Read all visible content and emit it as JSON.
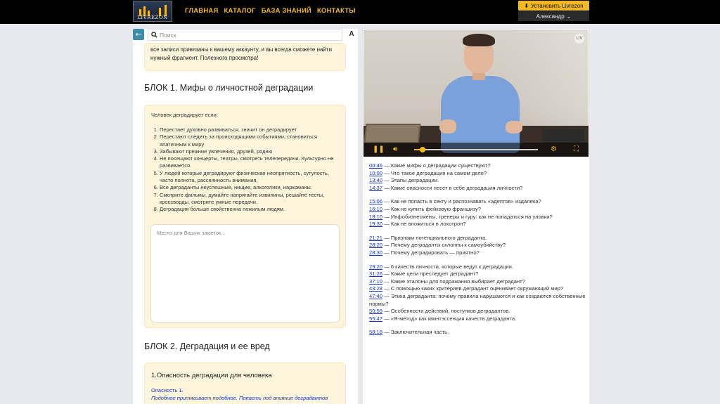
{
  "header": {
    "logo_text": "LIVREZON",
    "nav": [
      "ГЛАВНАЯ",
      "КАТАЛОГ",
      "БАЗА ЗНАНИЙ",
      "КОНТАКТЫ"
    ],
    "install_label": "Установить Livrezon",
    "user_name": "Александр",
    "accent_color": "#f3b81f"
  },
  "search": {
    "placeholder": "Поиск",
    "font_button": "A"
  },
  "notice": {
    "text": "все записи привязаны к вашему аккаунту, и вы всегда сможете найти нужный фрагмент. Полезного просмотра!"
  },
  "block1": {
    "title": "БЛОК 1. Мифы о личностной деградации",
    "intro": "Человек деградирует если:",
    "items": [
      "Перестает духовно развиваться, значит он деградирует",
      "Перестают следить за происходящими событиями, становиться апатичным к миру",
      "Забывают прежние увлечения, друзей, родню",
      "Не посещают концерты, театры, смотреть телепередачи. Культурно не развивается.",
      "У людей которые деградируют физическая неопрятность, сутулость, часто полнота, рассеянность внимания.",
      "Все деграданты неуспешные, нищие, алкоголики, наркоманы.",
      "Смотрите фильмы, думайте напрягайте извилины, решайте тесты, кроссворды, смотрите умные передачи.",
      "Деградация больше свойственна пожилым людям."
    ],
    "notes_placeholder": "Место для Ваших заметок..."
  },
  "block2": {
    "title": "БЛОК 2. Деградация и ее вред",
    "card_title": "1.Опасность деградации  для человека",
    "line1": "Опасность 1.",
    "line2": "Подобное притягивает подобное. Попасть под влияние деградантов"
  },
  "video": {
    "logo": "LIV"
  },
  "toc": [
    [
      {
        "time": "00:46",
        "text": "Какие мифы о деградации существуют?"
      },
      {
        "time": "10:00",
        "text": "Что такое деградация на самом деле?"
      },
      {
        "time": "13:40",
        "text": "Этапы деградации."
      },
      {
        "time": "14:37",
        "text": "Какие опасности несет в себе деградация личности?"
      }
    ],
    [
      {
        "time": "15:06",
        "text": "Как не попасть в секту и распознавать «адептов» издалека?"
      },
      {
        "time": "16:10",
        "text": "Как не купить фейковую франшизу?"
      },
      {
        "time": "18:10",
        "text": "Инфобизнесмены, тренеры и гуру: как не попадаться на уловки?"
      },
      {
        "time": "19:30",
        "text": "Как не вложиться в лохотрон?"
      }
    ],
    [
      {
        "time": "21:21",
        "text": "Признаки потенциального деграданта."
      },
      {
        "time": "28:20",
        "text": "Почему деграданты склонны к самоубийству?"
      },
      {
        "time": "28:30",
        "text": "Почему деградировать — приятно?"
      }
    ],
    [
      {
        "time": "29:20",
        "text": "6 качеств личности, которые ведут к деградации."
      },
      {
        "time": "31:26",
        "text": "Какие цели преследует деградант?"
      },
      {
        "time": "37:10",
        "text": "Какие эталоны для подражания выбирает деградант?"
      },
      {
        "time": "43:28",
        "text": "С помощью каких критериев деградант оценивает окружающий мир?"
      },
      {
        "time": "47:40",
        "text": "Этика деграданта: почему правила нарушаются и как создаются собственные нормы?"
      },
      {
        "time": "50:59",
        "text": "Особенности действий, поступков деградантов."
      },
      {
        "time": "55:47",
        "text": "«Я-метод» как квинтэссенция качеств деграданта."
      }
    ],
    [
      {
        "time": "58:18",
        "text": "Заключительная часть."
      }
    ]
  ]
}
